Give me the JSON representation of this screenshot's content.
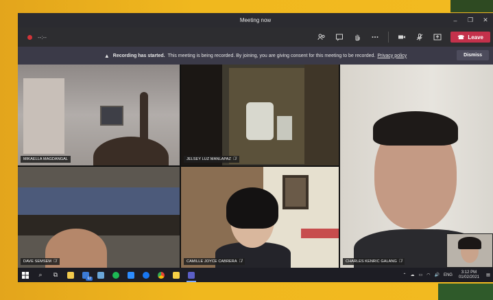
{
  "window": {
    "title": "Meeting now",
    "controls": {
      "minimize": "–",
      "maximize": "❐",
      "close": "✕"
    }
  },
  "toolbar": {
    "timer": "--:--",
    "tools": [
      "participants-icon",
      "chat-icon",
      "raise-hand-icon",
      "more-icon",
      "camera-icon",
      "mic-off-icon",
      "share-icon"
    ],
    "leave_label": "Leave",
    "leave_color": "#c4314b"
  },
  "banner": {
    "bold": "Recording has started.",
    "message": "This meeting is being recorded. By joining, you are giving consent for this meeting to be recorded.",
    "policy_link": "Privacy policy",
    "dismiss_label": "Dismiss"
  },
  "participants": [
    {
      "name": "MIKAELLA MAGDANGAL",
      "muted": false
    },
    {
      "name": "JELSEY LUZ MANLAPAZ",
      "muted": true
    },
    {
      "name": "CHARLES KENRIC GALANG",
      "muted": true
    },
    {
      "name": "DAVE SEMSEM",
      "muted": true
    },
    {
      "name": "CAMILLE JOYCE CABRERA",
      "muted": true
    }
  ],
  "taskbar": {
    "badge": "62",
    "tray": {
      "lang": "ENG",
      "time": "3:12 PM",
      "date": "01/02/2021"
    }
  }
}
